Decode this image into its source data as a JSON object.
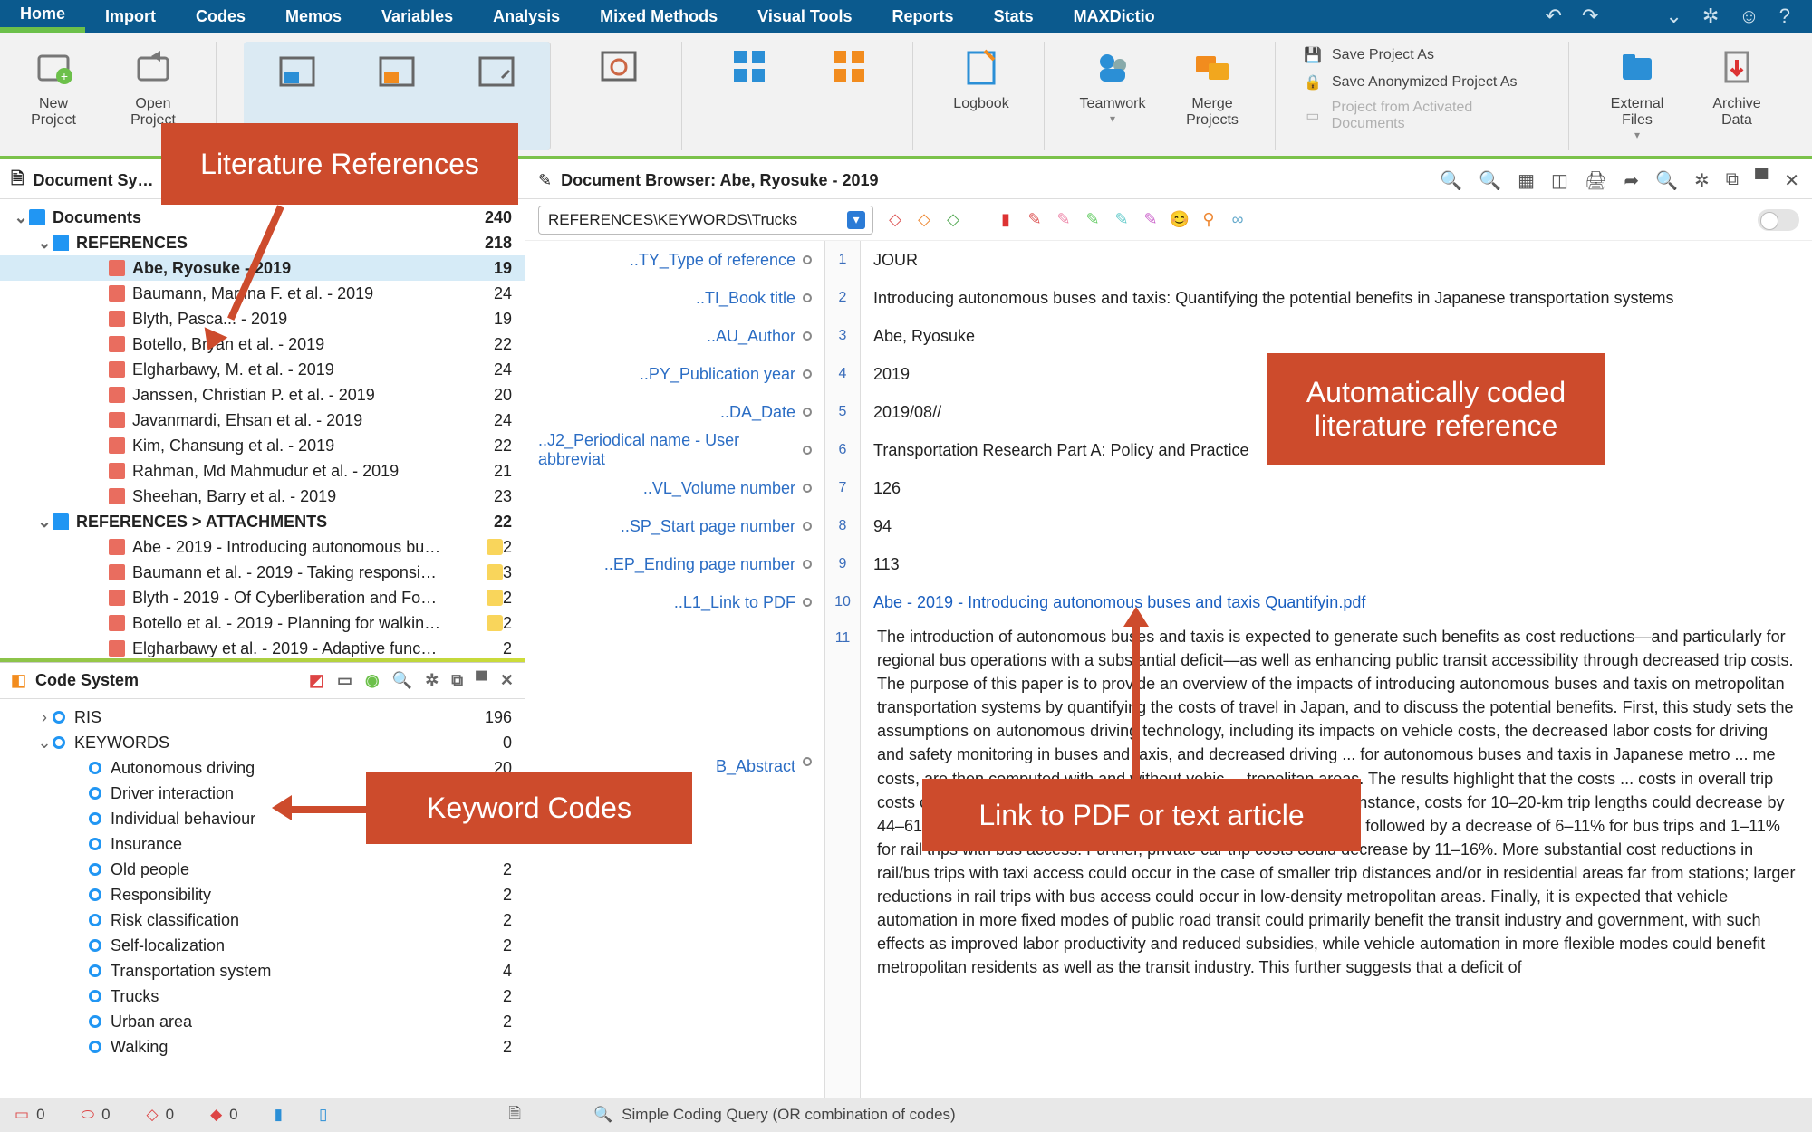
{
  "menu": {
    "tabs": [
      "Home",
      "Import",
      "Codes",
      "Memos",
      "Variables",
      "Analysis",
      "Mixed Methods",
      "Visual Tools",
      "Reports",
      "Stats",
      "MAXDictio"
    ],
    "active": 0
  },
  "ribbon": {
    "new_project": "New\nProject",
    "open_project": "Open\nProject",
    "logbook": "Logbook",
    "teamwork": "Teamwork",
    "merge": "Merge\nProjects",
    "save_as": "Save Project As",
    "save_anon": "Save Anonymized Project As",
    "proj_activated": "Project from Activated Documents",
    "external_files": "External\nFiles",
    "archive": "Archive\nData"
  },
  "docsys": {
    "title": "Document Sy…",
    "root": {
      "label": "Documents",
      "count": 240
    },
    "refs_folder": {
      "label": "REFERENCES",
      "count": 218
    },
    "refs": [
      {
        "label": "Abe, Ryosuke - 2019",
        "count": 19,
        "selected": true
      },
      {
        "label": "Baumann, Martina F. et al. - 2019",
        "count": 24
      },
      {
        "label": "Blyth, Pasca... - 2019",
        "count": 19
      },
      {
        "label": "Botello, Bryan et al. - 2019",
        "count": 22
      },
      {
        "label": "Elgharbawy, M. et al. - 2019",
        "count": 24
      },
      {
        "label": "Janssen, Christian P. et al. - 2019",
        "count": 20
      },
      {
        "label": "Javanmardi, Ehsan et al. - 2019",
        "count": 24
      },
      {
        "label": "Kim, Chansung et al. - 2019",
        "count": 22
      },
      {
        "label": "Rahman, Md Mahmudur et al. - 2019",
        "count": 21
      },
      {
        "label": "Sheehan, Barry et al. - 2019",
        "count": 23
      }
    ],
    "attach_folder": {
      "label": "REFERENCES > ATTACHMENTS",
      "count": 22
    },
    "attach": [
      {
        "label": "Abe - 2019 - Introducing autonomous bu…",
        "count": 2,
        "memo": true
      },
      {
        "label": "Baumann et al. - 2019 - Taking responsi…",
        "count": 3,
        "memo": true
      },
      {
        "label": "Blyth - 2019 - Of Cyberliberation and Fo…",
        "count": 2,
        "memo": true
      },
      {
        "label": "Botello et al. - 2019 - Planning for walkin…",
        "count": 2,
        "memo": true
      },
      {
        "label": "Elgharbawy et al. - 2019 - Adaptive func…",
        "count": 2,
        "memo": false
      }
    ]
  },
  "codesys": {
    "title": "Code System",
    "items": [
      {
        "label": "RIS",
        "count": 196,
        "indent": 1,
        "expand": ">"
      },
      {
        "label": "KEYWORDS",
        "count": 0,
        "indent": 1,
        "expand": "v"
      },
      {
        "label": "Autonomous driving",
        "count": 20,
        "indent": 2
      },
      {
        "label": "Driver interaction",
        "count": "",
        "indent": 2
      },
      {
        "label": "Individual behaviour",
        "count": "",
        "indent": 2
      },
      {
        "label": "Insurance",
        "count": "",
        "indent": 2
      },
      {
        "label": "Old people",
        "count": 2,
        "indent": 2
      },
      {
        "label": "Responsibility",
        "count": 2,
        "indent": 2
      },
      {
        "label": "Risk classification",
        "count": 2,
        "indent": 2
      },
      {
        "label": "Self-localization",
        "count": 2,
        "indent": 2
      },
      {
        "label": "Transportation system",
        "count": 4,
        "indent": 2
      },
      {
        "label": "Trucks",
        "count": 2,
        "indent": 2
      },
      {
        "label": "Urban area",
        "count": 2,
        "indent": 2
      },
      {
        "label": "Walking",
        "count": 2,
        "indent": 2
      }
    ]
  },
  "browser": {
    "title": "Document Browser: Abe, Ryosuke - 2019",
    "combo": "REFERENCES\\KEYWORDS\\Trucks",
    "rows": [
      {
        "label": "..TY_Type of reference",
        "n": 1,
        "val": "JOUR"
      },
      {
        "label": "..TI_Book title",
        "n": 2,
        "val": "Introducing autonomous buses and taxis: Quantifying the potential benefits in Japanese transportation systems"
      },
      {
        "label": "..AU_Author",
        "n": 3,
        "val": "Abe, Ryosuke"
      },
      {
        "label": "..PY_Publication year",
        "n": 4,
        "val": "2019"
      },
      {
        "label": "..DA_Date",
        "n": 5,
        "val": "2019/08//"
      },
      {
        "label": "..J2_Periodical name - User abbreviat",
        "n": 6,
        "val": "Transportation Research Part A: Policy and Practice"
      },
      {
        "label": "..VL_Volume number",
        "n": 7,
        "val": "126"
      },
      {
        "label": "..SP_Start page number",
        "n": 8,
        "val": "94"
      },
      {
        "label": "..EP_Ending page number",
        "n": 9,
        "val": "113"
      },
      {
        "label": "..L1_Link to PDF",
        "n": 10,
        "val": "Abe - 2019 - Introducing autonomous buses and taxis Quantifyin.pdf",
        "link": true
      }
    ],
    "abstract_label": "B_Abstract",
    "abstract_n": 11,
    "abstract": "The introduction of autonomous buses and taxis is expected to generate such benefits as cost reductions—and particularly for regional bus operations with a substantial deficit—as well as enhancing public transit accessibility through decreased trip costs. The purpose of this paper is to provide an overview of the impacts of introducing autonomous buses and taxis on metropolitan transportation systems by quantifying the costs of travel in Japan, and to discuss the potential benefits. First, this study sets the assumptions on autonomous driving technology, including its impacts on vehicle costs, the decreased labor costs for driving and safety monitoring in buses and taxis, and decreased driving ... for autonomous buses and taxis in Japanese metro ... me costs, are then computed with and without vehic ... tropolitan areas. The results highlight that the costs ... costs in overall trip costs could decrease considerably due to vehicle automation. For instance, costs for 10–20-km trip lengths could decrease by 44–61% for taxi trips and 13–37% for rail/bus trips with taxi access, followed by a decrease of 6–11% for bus trips and 1–11% for rail trips with bus access. Further, private car trip costs could decrease by 11–16%. More substantial cost reductions in rail/bus trips with taxi access could occur in the case of smaller trip distances and/or in residential areas far from stations; larger reductions in rail trips with bus access could occur in low-density metropolitan areas. Finally, it is expected that vehicle automation in more fixed modes of public road transit could primarily benefit the transit industry and government, with such effects as improved labor productivity and reduced subsidies, while vehicle automation in more flexible modes could benefit metropolitan residents as well as the transit industry. This further suggests that a deficit of"
  },
  "status": {
    "query": "Simple Coding Query (OR combination of codes)",
    "counts": [
      "0",
      "0",
      "0",
      "0"
    ]
  },
  "callouts": {
    "litref": "Literature References",
    "keyword": "Keyword Codes",
    "autocoded": "Automatically coded\nliterature reference",
    "pdflink": "Link to PDF or text article"
  }
}
